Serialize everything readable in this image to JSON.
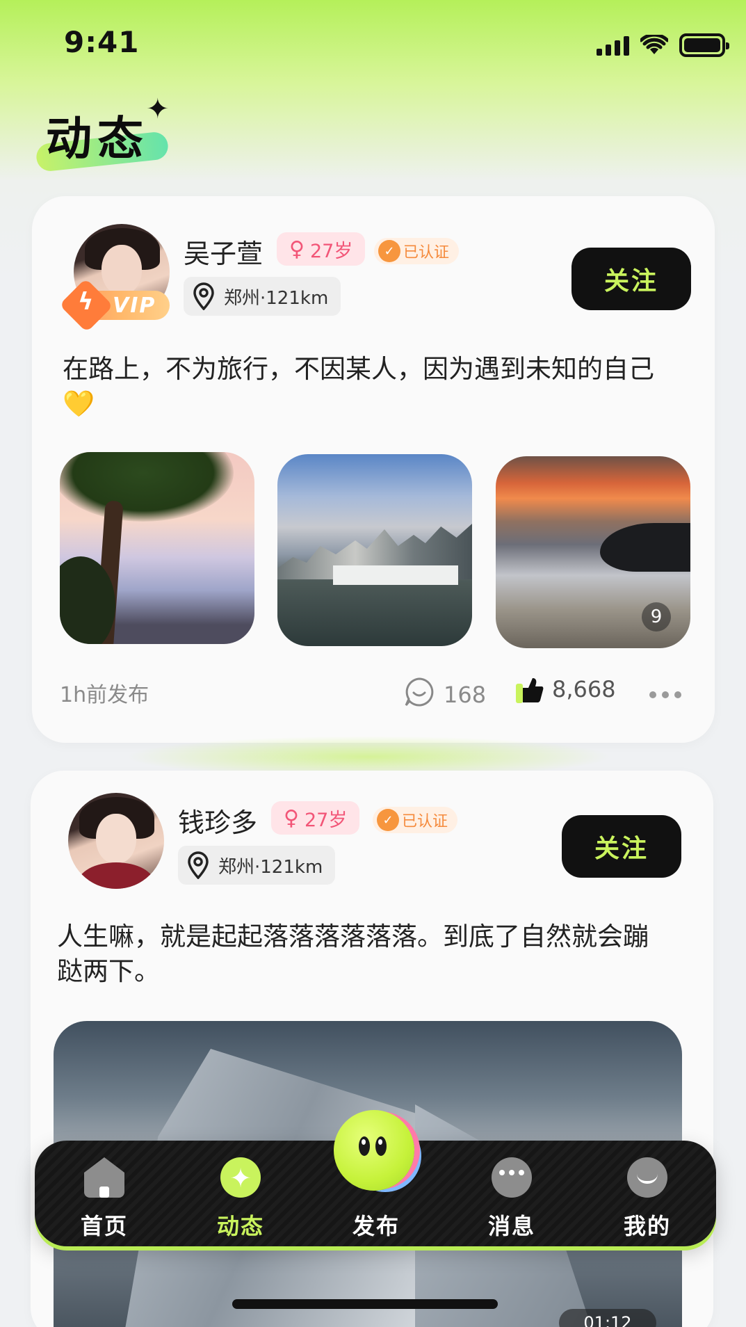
{
  "status_bar": {
    "time": "9:41"
  },
  "header": {
    "title": "动态"
  },
  "posts": [
    {
      "username": "吴子萱",
      "age": "27岁",
      "verified": "已认证",
      "vip_label": "VIP",
      "location": "郑州·121km",
      "follow_label": "关注",
      "text": "在路上，不为旅行，不因某人，因为遇到未知的自己💛",
      "photo_count": "9",
      "time": "1h前发布",
      "comments": "168",
      "likes": "8,668"
    },
    {
      "username": "钱珍多",
      "age": "27岁",
      "verified": "已认证",
      "location": "郑州·121km",
      "follow_label": "关注",
      "text": "人生嘛，就是起起落落落落落落。到底了自然就会蹦跶两下。",
      "video_time": "01:12"
    }
  ],
  "tabbar": {
    "items": [
      {
        "label": "首页",
        "icon": "home-icon"
      },
      {
        "label": "动态",
        "icon": "moments-icon"
      },
      {
        "label": "发布",
        "icon": "publish-icon"
      },
      {
        "label": "消息",
        "icon": "message-icon"
      },
      {
        "label": "我的",
        "icon": "profile-icon"
      }
    ],
    "active_color": "#c9f35d"
  },
  "colors": {
    "accent": "#c9f35d",
    "follow_bg": "#111111",
    "age_badge": "#f25577",
    "verified": "#f58a3c"
  }
}
